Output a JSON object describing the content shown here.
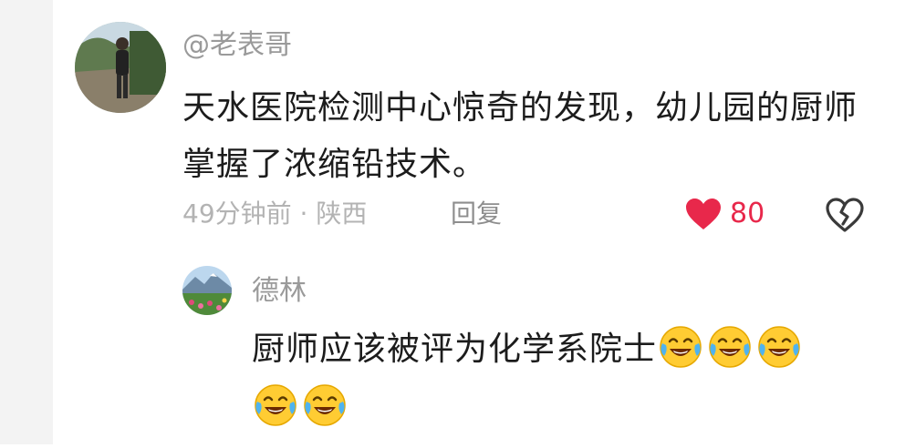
{
  "comment": {
    "username": "@老表哥",
    "text": "天水医院检测中心惊奇的发现，幼儿园的厨师掌握了浓缩铅技术。",
    "time": "49分钟前",
    "separator": " · ",
    "location": "陕西",
    "reply_label": "回复",
    "likes": "80",
    "avatar_icon": "user-photo-avatar",
    "like_icon": "heart-icon",
    "dislike_icon": "broken-heart-icon"
  },
  "reply": {
    "username": "德林",
    "text": "厨师应该被评为化学系院士",
    "emojis": [
      "rolling-laughing-emoji",
      "rolling-laughing-emoji",
      "rolling-laughing-emoji",
      "rolling-laughing-emoji",
      "rolling-laughing-emoji"
    ],
    "avatar_icon": "landscape-avatar"
  },
  "colors": {
    "text_primary": "#1c1c1c",
    "text_secondary": "#9a9a9a",
    "like_red": "#e8284b"
  }
}
